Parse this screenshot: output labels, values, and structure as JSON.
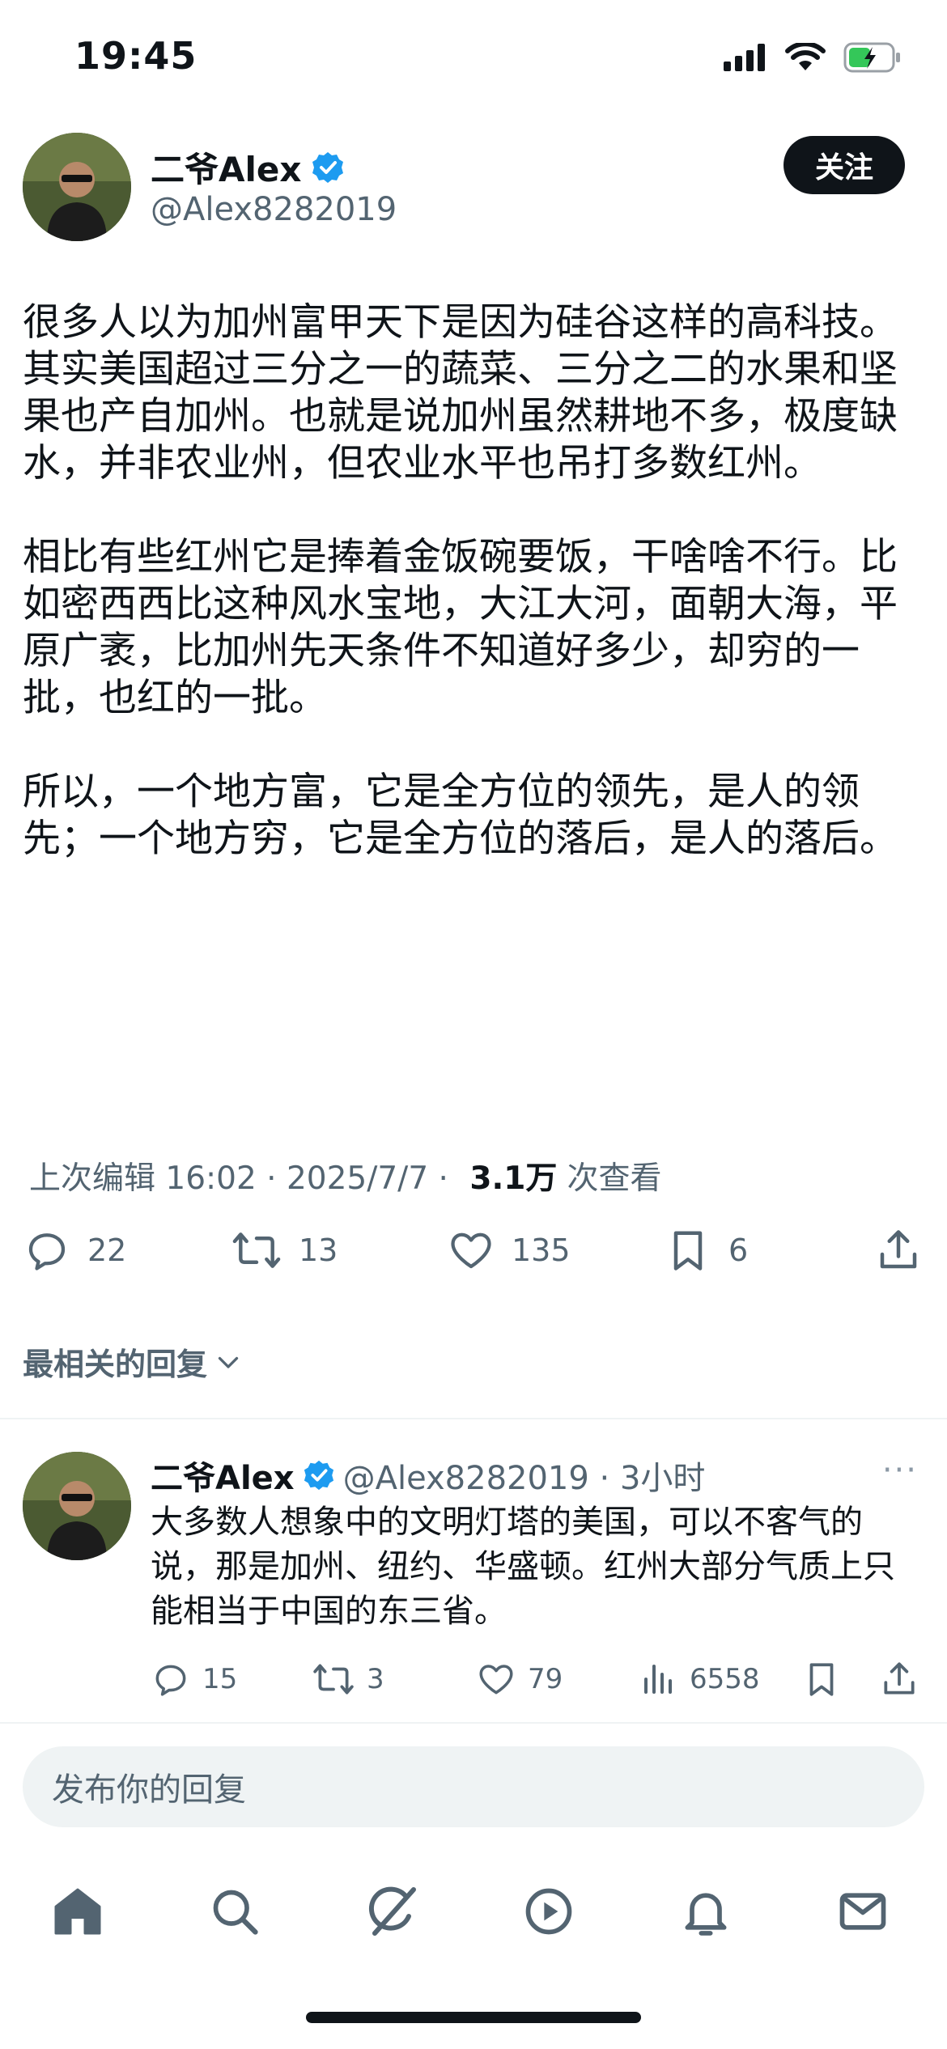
{
  "status_bar": {
    "time": "19:45"
  },
  "author": {
    "name": "二爷Alex",
    "handle": "@Alex8282019",
    "follow_label": "关注"
  },
  "tweet": {
    "paragraphs": [
      "很多人以为加州富甲天下是因为硅谷这样的高科技。其实美国超过三分之一的蔬菜、三分之二的水果和坚果也产自加州。也就是说加州虽然耕地不多，极度缺水，并非农业州，但农业水平也吊打多数红州。",
      "相比有些红州它是捧着金饭碗要饭，干啥啥不行。比如密西西比这种风水宝地，大江大河，面朝大海，平原广袤，比加州先天条件不知道好多少，却穷的一批，也红的一批。",
      "所以，一个地方富，它是全方位的领先，是人的领先；一个地方穷，它是全方位的落后，是人的落后。"
    ],
    "meta_edited": "上次编辑 16:02 · 2025/7/7",
    "meta_sep": " · ",
    "views_count": "3.1万",
    "views_label": "次查看",
    "replies": "22",
    "retweets": "13",
    "likes": "135",
    "bookmarks": "6"
  },
  "relevant_label": "最相关的回复",
  "reply": {
    "name": "二爷Alex",
    "handle_time": "@Alex8282019 · 3小时",
    "more": "···",
    "text": "大多数人想象中的文明灯塔的美国，可以不客气的说，那是加州、纽约、华盛顿。红州大部分气质上只能相当于中国的东三省。",
    "replies": "15",
    "retweets": "3",
    "likes": "79",
    "views": "6558"
  },
  "reply_input_placeholder": "发布你的回复",
  "colors": {
    "accent": "#1d9bf0",
    "text": "#0f1419",
    "muted": "#536471",
    "battery": "#34c759"
  },
  "icons": [
    "signal-icon",
    "wifi-icon",
    "battery-icon",
    "verified-icon",
    "reply-icon",
    "retweet-icon",
    "like-icon",
    "bookmark-icon",
    "share-icon",
    "views-icon",
    "home-icon",
    "search-icon",
    "grok-icon",
    "video-icon",
    "bell-icon",
    "mail-icon"
  ]
}
